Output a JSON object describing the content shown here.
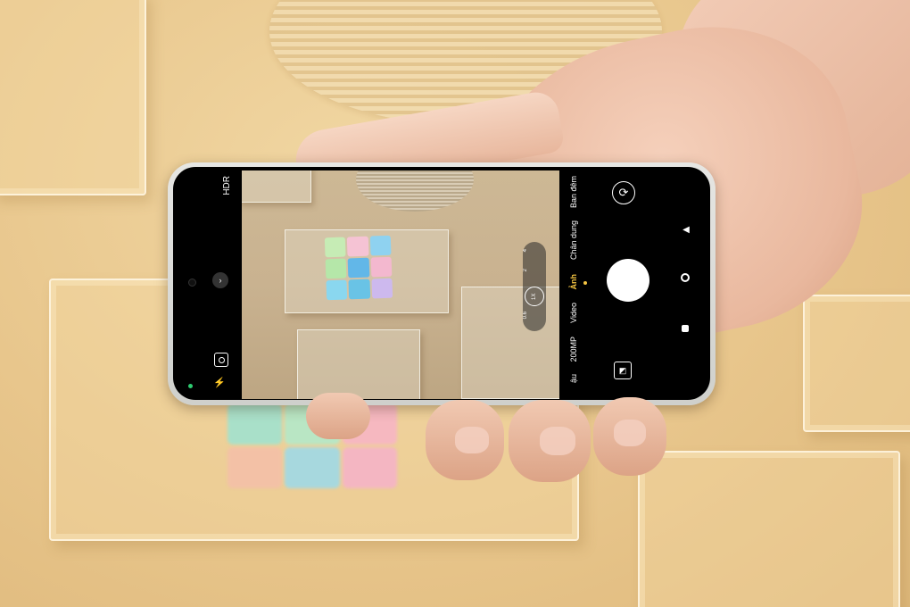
{
  "camera": {
    "hdr_label": "HDR",
    "modes": [
      "Ban đêm",
      "Chân dung",
      "Ảnh",
      "Video",
      "200MP",
      "ậu"
    ],
    "active_mode": "Ảnh",
    "zoom_levels": [
      "4",
      "2",
      "1X",
      "0.6"
    ],
    "active_zoom": "1X"
  },
  "icons": {
    "switch_camera": "rotate-camera-icon",
    "gallery": "gallery-thumbnail-icon",
    "expand": "chevron-icon",
    "scan": "scan-icon",
    "flash": "flash-off-icon",
    "back": "nav-back-icon",
    "home": "nav-home-icon",
    "recents": "nav-recents-icon"
  },
  "colors": {
    "background": "#e9c98f",
    "active_dot": "#f5c542",
    "status_dot": "#2ecc71"
  }
}
